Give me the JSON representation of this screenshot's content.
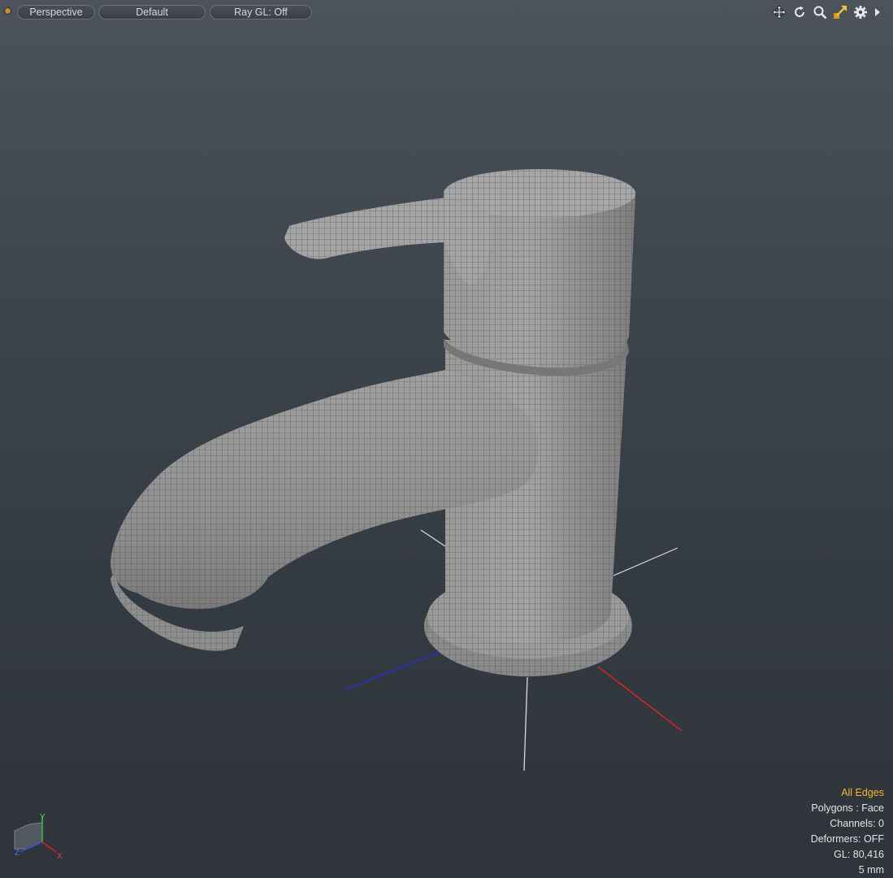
{
  "viewport": {
    "view_label": "Perspective",
    "shading_label": "Default",
    "raygl_label": "Ray GL: Off"
  },
  "toolbar_icons": [
    "move-view-icon",
    "rotate-view-icon",
    "zoom-view-icon",
    "maximize-view-icon",
    "settings-icon",
    "expand-arrow-icon"
  ],
  "hud": {
    "mode": "All Edges",
    "polygons": "Polygons : Face",
    "channels": "Channels: 0",
    "deformers": "Deformers: OFF",
    "gl": "GL: 80,416",
    "grid": "5 mm"
  },
  "gizmo": {
    "y": "Y",
    "x": "X",
    "z": "Z"
  },
  "colors": {
    "mode_accent": "#f0b830",
    "axis_x": "#c8282a",
    "axis_z": "#2730c0",
    "mesh_fill": "#8e8e8e"
  }
}
